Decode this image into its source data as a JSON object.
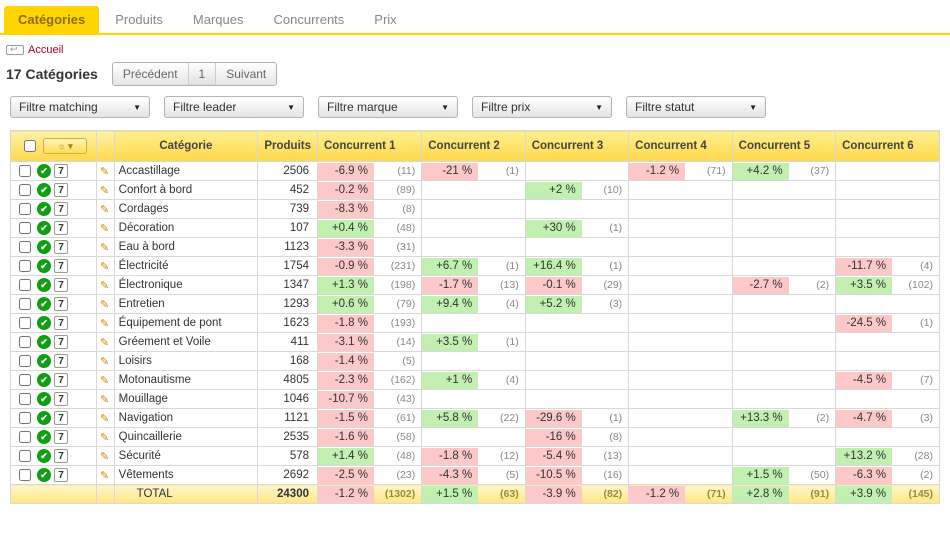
{
  "tabs": [
    {
      "label": "Catégories",
      "active": true
    },
    {
      "label": "Produits",
      "active": false
    },
    {
      "label": "Marques",
      "active": false
    },
    {
      "label": "Concurrents",
      "active": false
    },
    {
      "label": "Prix",
      "active": false
    }
  ],
  "breadcrumb": {
    "home": "Accueil"
  },
  "header": {
    "count": "17 Catégories"
  },
  "pager": {
    "prev": "Précédent",
    "page": "1",
    "next": "Suivant"
  },
  "filters": {
    "matching": "Filtre matching",
    "leader": "Filtre leader",
    "marque": "Filtre marque",
    "prix": "Filtre prix",
    "statut": "Filtre statut"
  },
  "columns": {
    "cat": "Catégorie",
    "prod": "Produits",
    "c1": "Concurrent 1",
    "c2": "Concurrent 2",
    "c3": "Concurrent 3",
    "c4": "Concurrent 4",
    "c5": "Concurrent 5",
    "c6": "Concurrent 6"
  },
  "rows": [
    {
      "name": "Accastillage",
      "prod": "2506",
      "c1": {
        "pct": "-6.9 %",
        "cnt": "(11)"
      },
      "c2": {
        "pct": "-21 %",
        "cnt": "(1)"
      },
      "c3": null,
      "c4": {
        "pct": "-1.2 %",
        "cnt": "(71)"
      },
      "c5": {
        "pct": "+4.2 %",
        "cnt": "(37)"
      },
      "c6": null
    },
    {
      "name": "Confort à bord",
      "prod": "452",
      "c1": {
        "pct": "-0.2 %",
        "cnt": "(89)"
      },
      "c2": null,
      "c3": {
        "pct": "+2 %",
        "cnt": "(10)"
      },
      "c4": null,
      "c5": null,
      "c6": null
    },
    {
      "name": "Cordages",
      "prod": "739",
      "c1": {
        "pct": "-8.3 %",
        "cnt": "(8)"
      },
      "c2": null,
      "c3": null,
      "c4": null,
      "c5": null,
      "c6": null
    },
    {
      "name": "Décoration",
      "prod": "107",
      "c1": {
        "pct": "+0.4 %",
        "cnt": "(48)"
      },
      "c2": null,
      "c3": {
        "pct": "+30 %",
        "cnt": "(1)"
      },
      "c4": null,
      "c5": null,
      "c6": null
    },
    {
      "name": "Eau à bord",
      "prod": "1123",
      "c1": {
        "pct": "-3.3 %",
        "cnt": "(31)"
      },
      "c2": null,
      "c3": null,
      "c4": null,
      "c5": null,
      "c6": null
    },
    {
      "name": "Électricité",
      "prod": "1754",
      "c1": {
        "pct": "-0.9 %",
        "cnt": "(231)"
      },
      "c2": {
        "pct": "+6.7 %",
        "cnt": "(1)"
      },
      "c3": {
        "pct": "+16.4 %",
        "cnt": "(1)"
      },
      "c4": null,
      "c5": null,
      "c6": {
        "pct": "-11.7 %",
        "cnt": "(4)"
      }
    },
    {
      "name": "Électronique",
      "prod": "1347",
      "c1": {
        "pct": "+1.3 %",
        "cnt": "(198)"
      },
      "c2": {
        "pct": "-1.7 %",
        "cnt": "(13)"
      },
      "c3": {
        "pct": "-0.1 %",
        "cnt": "(29)"
      },
      "c4": null,
      "c5": {
        "pct": "-2.7 %",
        "cnt": "(2)"
      },
      "c6": {
        "pct": "+3.5 %",
        "cnt": "(102)"
      }
    },
    {
      "name": "Entretien",
      "prod": "1293",
      "c1": {
        "pct": "+0.6 %",
        "cnt": "(79)"
      },
      "c2": {
        "pct": "+9.4 %",
        "cnt": "(4)"
      },
      "c3": {
        "pct": "+5.2 %",
        "cnt": "(3)"
      },
      "c4": null,
      "c5": null,
      "c6": null
    },
    {
      "name": "Équipement de pont",
      "prod": "1623",
      "c1": {
        "pct": "-1.8 %",
        "cnt": "(193)"
      },
      "c2": null,
      "c3": null,
      "c4": null,
      "c5": null,
      "c6": {
        "pct": "-24.5 %",
        "cnt": "(1)"
      }
    },
    {
      "name": "Gréement et Voile",
      "prod": "411",
      "c1": {
        "pct": "-3.1 %",
        "cnt": "(14)"
      },
      "c2": {
        "pct": "+3.5 %",
        "cnt": "(1)"
      },
      "c3": null,
      "c4": null,
      "c5": null,
      "c6": null
    },
    {
      "name": "Loisirs",
      "prod": "168",
      "c1": {
        "pct": "-1.4 %",
        "cnt": "(5)"
      },
      "c2": null,
      "c3": null,
      "c4": null,
      "c5": null,
      "c6": null
    },
    {
      "name": "Motonautisme",
      "prod": "4805",
      "c1": {
        "pct": "-2.3 %",
        "cnt": "(162)"
      },
      "c2": {
        "pct": "+1 %",
        "cnt": "(4)"
      },
      "c3": null,
      "c4": null,
      "c5": null,
      "c6": {
        "pct": "-4.5 %",
        "cnt": "(7)"
      }
    },
    {
      "name": "Mouillage",
      "prod": "1046",
      "c1": {
        "pct": "-10.7 %",
        "cnt": "(43)"
      },
      "c2": null,
      "c3": null,
      "c4": null,
      "c5": null,
      "c6": null
    },
    {
      "name": "Navigation",
      "prod": "1121",
      "c1": {
        "pct": "-1.5 %",
        "cnt": "(61)"
      },
      "c2": {
        "pct": "+5.8 %",
        "cnt": "(22)"
      },
      "c3": {
        "pct": "-29.6 %",
        "cnt": "(1)"
      },
      "c4": null,
      "c5": {
        "pct": "+13.3 %",
        "cnt": "(2)"
      },
      "c6": {
        "pct": "-4.7 %",
        "cnt": "(3)"
      }
    },
    {
      "name": "Quincaillerie",
      "prod": "2535",
      "c1": {
        "pct": "-1.6 %",
        "cnt": "(58)"
      },
      "c2": null,
      "c3": {
        "pct": "-16 %",
        "cnt": "(8)"
      },
      "c4": null,
      "c5": null,
      "c6": null
    },
    {
      "name": "Sécurité",
      "prod": "578",
      "c1": {
        "pct": "+1.4 %",
        "cnt": "(48)"
      },
      "c2": {
        "pct": "-1.8 %",
        "cnt": "(12)"
      },
      "c3": {
        "pct": "-5.4 %",
        "cnt": "(13)"
      },
      "c4": null,
      "c5": null,
      "c6": {
        "pct": "+13.2 %",
        "cnt": "(28)"
      }
    },
    {
      "name": "Vêtements",
      "prod": "2692",
      "c1": {
        "pct": "-2.5 %",
        "cnt": "(23)"
      },
      "c2": {
        "pct": "-4.3 %",
        "cnt": "(5)"
      },
      "c3": {
        "pct": "-10.5 %",
        "cnt": "(16)"
      },
      "c4": null,
      "c5": {
        "pct": "+1.5 %",
        "cnt": "(50)"
      },
      "c6": {
        "pct": "-6.3 %",
        "cnt": "(2)"
      }
    }
  ],
  "total": {
    "label": "TOTAL",
    "prod": "24300",
    "c1": {
      "pct": "-1.2 %",
      "cnt": "(1302)"
    },
    "c2": {
      "pct": "+1.5 %",
      "cnt": "(63)"
    },
    "c3": {
      "pct": "-3.9 %",
      "cnt": "(82)"
    },
    "c4": {
      "pct": "-1.2 %",
      "cnt": "(71)"
    },
    "c5": {
      "pct": "+2.8 %",
      "cnt": "(91)"
    },
    "c6": {
      "pct": "+3.9 %",
      "cnt": "(145)"
    }
  }
}
